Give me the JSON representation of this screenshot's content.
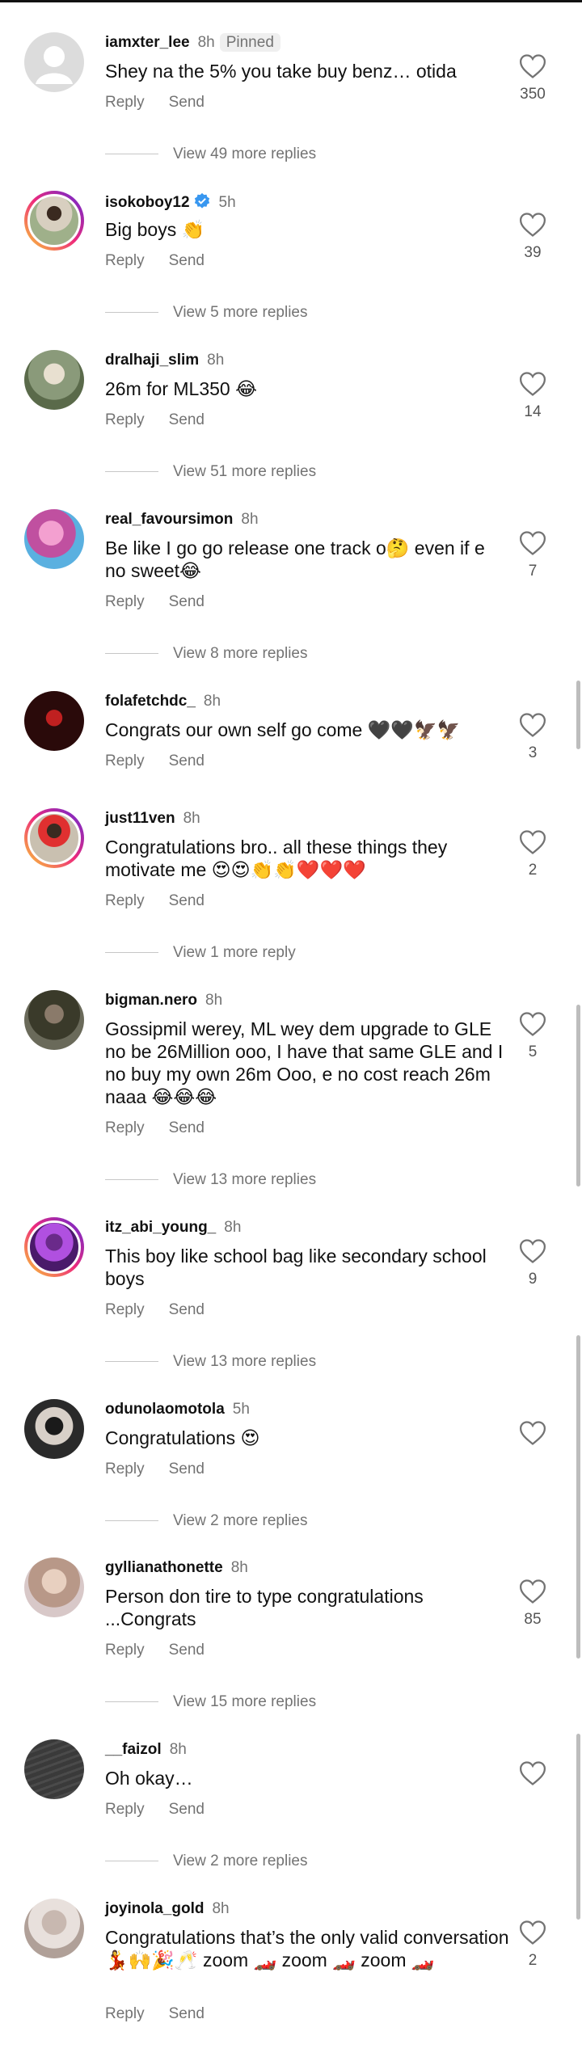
{
  "labels": {
    "reply": "Reply",
    "send": "Send"
  },
  "comments": [
    {
      "username": "iamxter_lee",
      "time": "8h",
      "pinned": "Pinned",
      "text": "Shey na the 5% you take buy benz… otida",
      "likes": "350",
      "view_more": "View 49 more replies",
      "avatar_color": "#d9d9d9"
    },
    {
      "username": "isokoboy12",
      "time": "5h",
      "text": "Big boys 👏",
      "likes": "39",
      "view_more": "View 5 more replies",
      "avatar_color": "#c9b79a"
    },
    {
      "username": "dralhaji_slim",
      "time": "8h",
      "text": "26m for ML350 😂",
      "likes": "14",
      "view_more": "View 51 more replies",
      "avatar_color": "#7a8a6a"
    },
    {
      "username": "real_favoursimon",
      "time": "8h",
      "text": "Be like I go go release one track o🤔 even if e no sweet😂",
      "likes": "7",
      "view_more": "View 8 more replies",
      "avatar_color": "#e07ab8"
    },
    {
      "username": "folafetchdc_",
      "time": "8h",
      "text": "Congrats our own self go come 🖤🖤🦅🦅",
      "likes": "3",
      "avatar_color": "#2a1212"
    },
    {
      "username": "just11ven",
      "time": "8h",
      "text": "Congratulations bro.. all these things they motivate me 😍😍👏👏❤️❤️❤️",
      "likes": "2",
      "view_more": "View 1 more reply",
      "avatar_color": "#c9a58a"
    },
    {
      "username": "bigman.nero",
      "time": "8h",
      "text": "Gossipmil werey, ML wey dem upgrade to GLE no be 26Million ooo, I have that same GLE and I no buy my own 26m Ooo, e no cost reach 26m naaa 😂😂😂",
      "likes": "5",
      "view_more": "View 13 more replies",
      "avatar_color": "#4a4a3a"
    },
    {
      "username": "itz_abi_young_",
      "time": "8h",
      "text": "This boy like school bag like secondary school boys",
      "likes": "9",
      "view_more": "View 13 more replies",
      "avatar_color": "#8a3ab8"
    },
    {
      "username": "odunolaomotola",
      "time": "5h",
      "text": "Congratulations 😍",
      "likes": "",
      "view_more": "View 2 more replies",
      "avatar_color": "#2a2a2a"
    },
    {
      "username": "gyllianathonette",
      "time": "8h",
      "text": "Person don tire to type congratulations ...Congrats",
      "likes": "85",
      "view_more": "View 15 more replies",
      "avatar_color": "#c8a89a"
    },
    {
      "username": "__faizol",
      "time": "8h",
      "text": "Oh okay…",
      "likes": "",
      "view_more": "View 2 more replies",
      "avatar_color": "#3a3a3a"
    },
    {
      "username": "joyinola_gold",
      "time": "8h",
      "text": "Congratulations that’s the only valid conversation 💃🙌🎉🥂 zoom 🏎️ zoom 🏎️ zoom 🏎️",
      "likes": "2",
      "avatar_color": "#d8c8c0"
    }
  ]
}
